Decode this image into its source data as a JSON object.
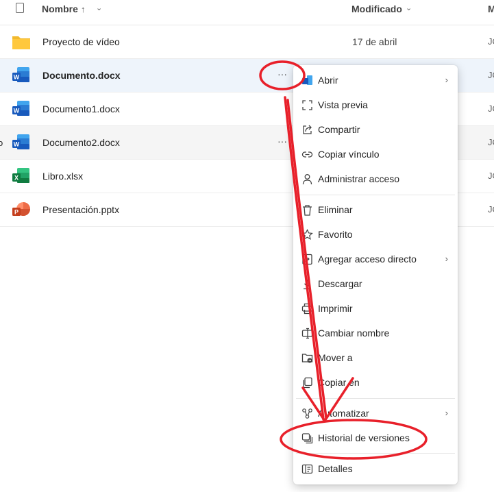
{
  "header": {
    "name_label": "Nombre",
    "sort_glyph": "↑",
    "name_chevron": "⌄",
    "modified_label": "Modificado",
    "modified_chevron": "⌄",
    "extra_label": "M"
  },
  "files": [
    {
      "name": "Proyecto de vídeo",
      "modified": "17 de abril",
      "owner": "JO",
      "icon": "folder-icon"
    },
    {
      "name": "Documento.docx",
      "modified": "",
      "owner": "JO",
      "icon": "word-icon",
      "more": "···"
    },
    {
      "name": "Documento1.docx",
      "modified": "",
      "owner": "JO",
      "icon": "word-icon"
    },
    {
      "name": "Documento2.docx",
      "modified": "",
      "owner": "JO",
      "icon": "word-icon",
      "more": "···",
      "left_mark": "o"
    },
    {
      "name": "Libro.xlsx",
      "modified": "",
      "owner": "JO",
      "icon": "excel-icon"
    },
    {
      "name": "Presentación.pptx",
      "modified": "",
      "owner": "JO",
      "icon": "powerpoint-icon"
    }
  ],
  "context_menu": {
    "items": [
      {
        "label": "Abrir",
        "icon": "open-icon",
        "submenu": "›"
      },
      {
        "label": "Vista previa",
        "icon": "preview-icon"
      },
      {
        "label": "Compartir",
        "icon": "share-icon"
      },
      {
        "label": "Copiar vínculo",
        "icon": "link-icon"
      },
      {
        "label": "Administrar acceso",
        "icon": "person-icon"
      },
      {
        "label": "Eliminar",
        "icon": "trash-icon"
      },
      {
        "label": "Favorito",
        "icon": "star-icon"
      },
      {
        "label": "Agregar acceso directo",
        "icon": "shortcut-icon",
        "submenu": "›"
      },
      {
        "label": "Descargar",
        "icon": "download-icon"
      },
      {
        "label": "Imprimir",
        "icon": "print-icon"
      },
      {
        "label": "Cambiar nombre",
        "icon": "rename-icon"
      },
      {
        "label": "Mover a",
        "icon": "move-icon"
      },
      {
        "label": "Copiar en",
        "icon": "copy-icon"
      },
      {
        "label": "Automatizar",
        "icon": "automate-icon",
        "submenu": "›"
      },
      {
        "label": "Historial de versiones",
        "icon": "version-history-icon"
      },
      {
        "label": "Detalles",
        "icon": "details-icon"
      }
    ]
  },
  "annotation_color": "#e8202a"
}
